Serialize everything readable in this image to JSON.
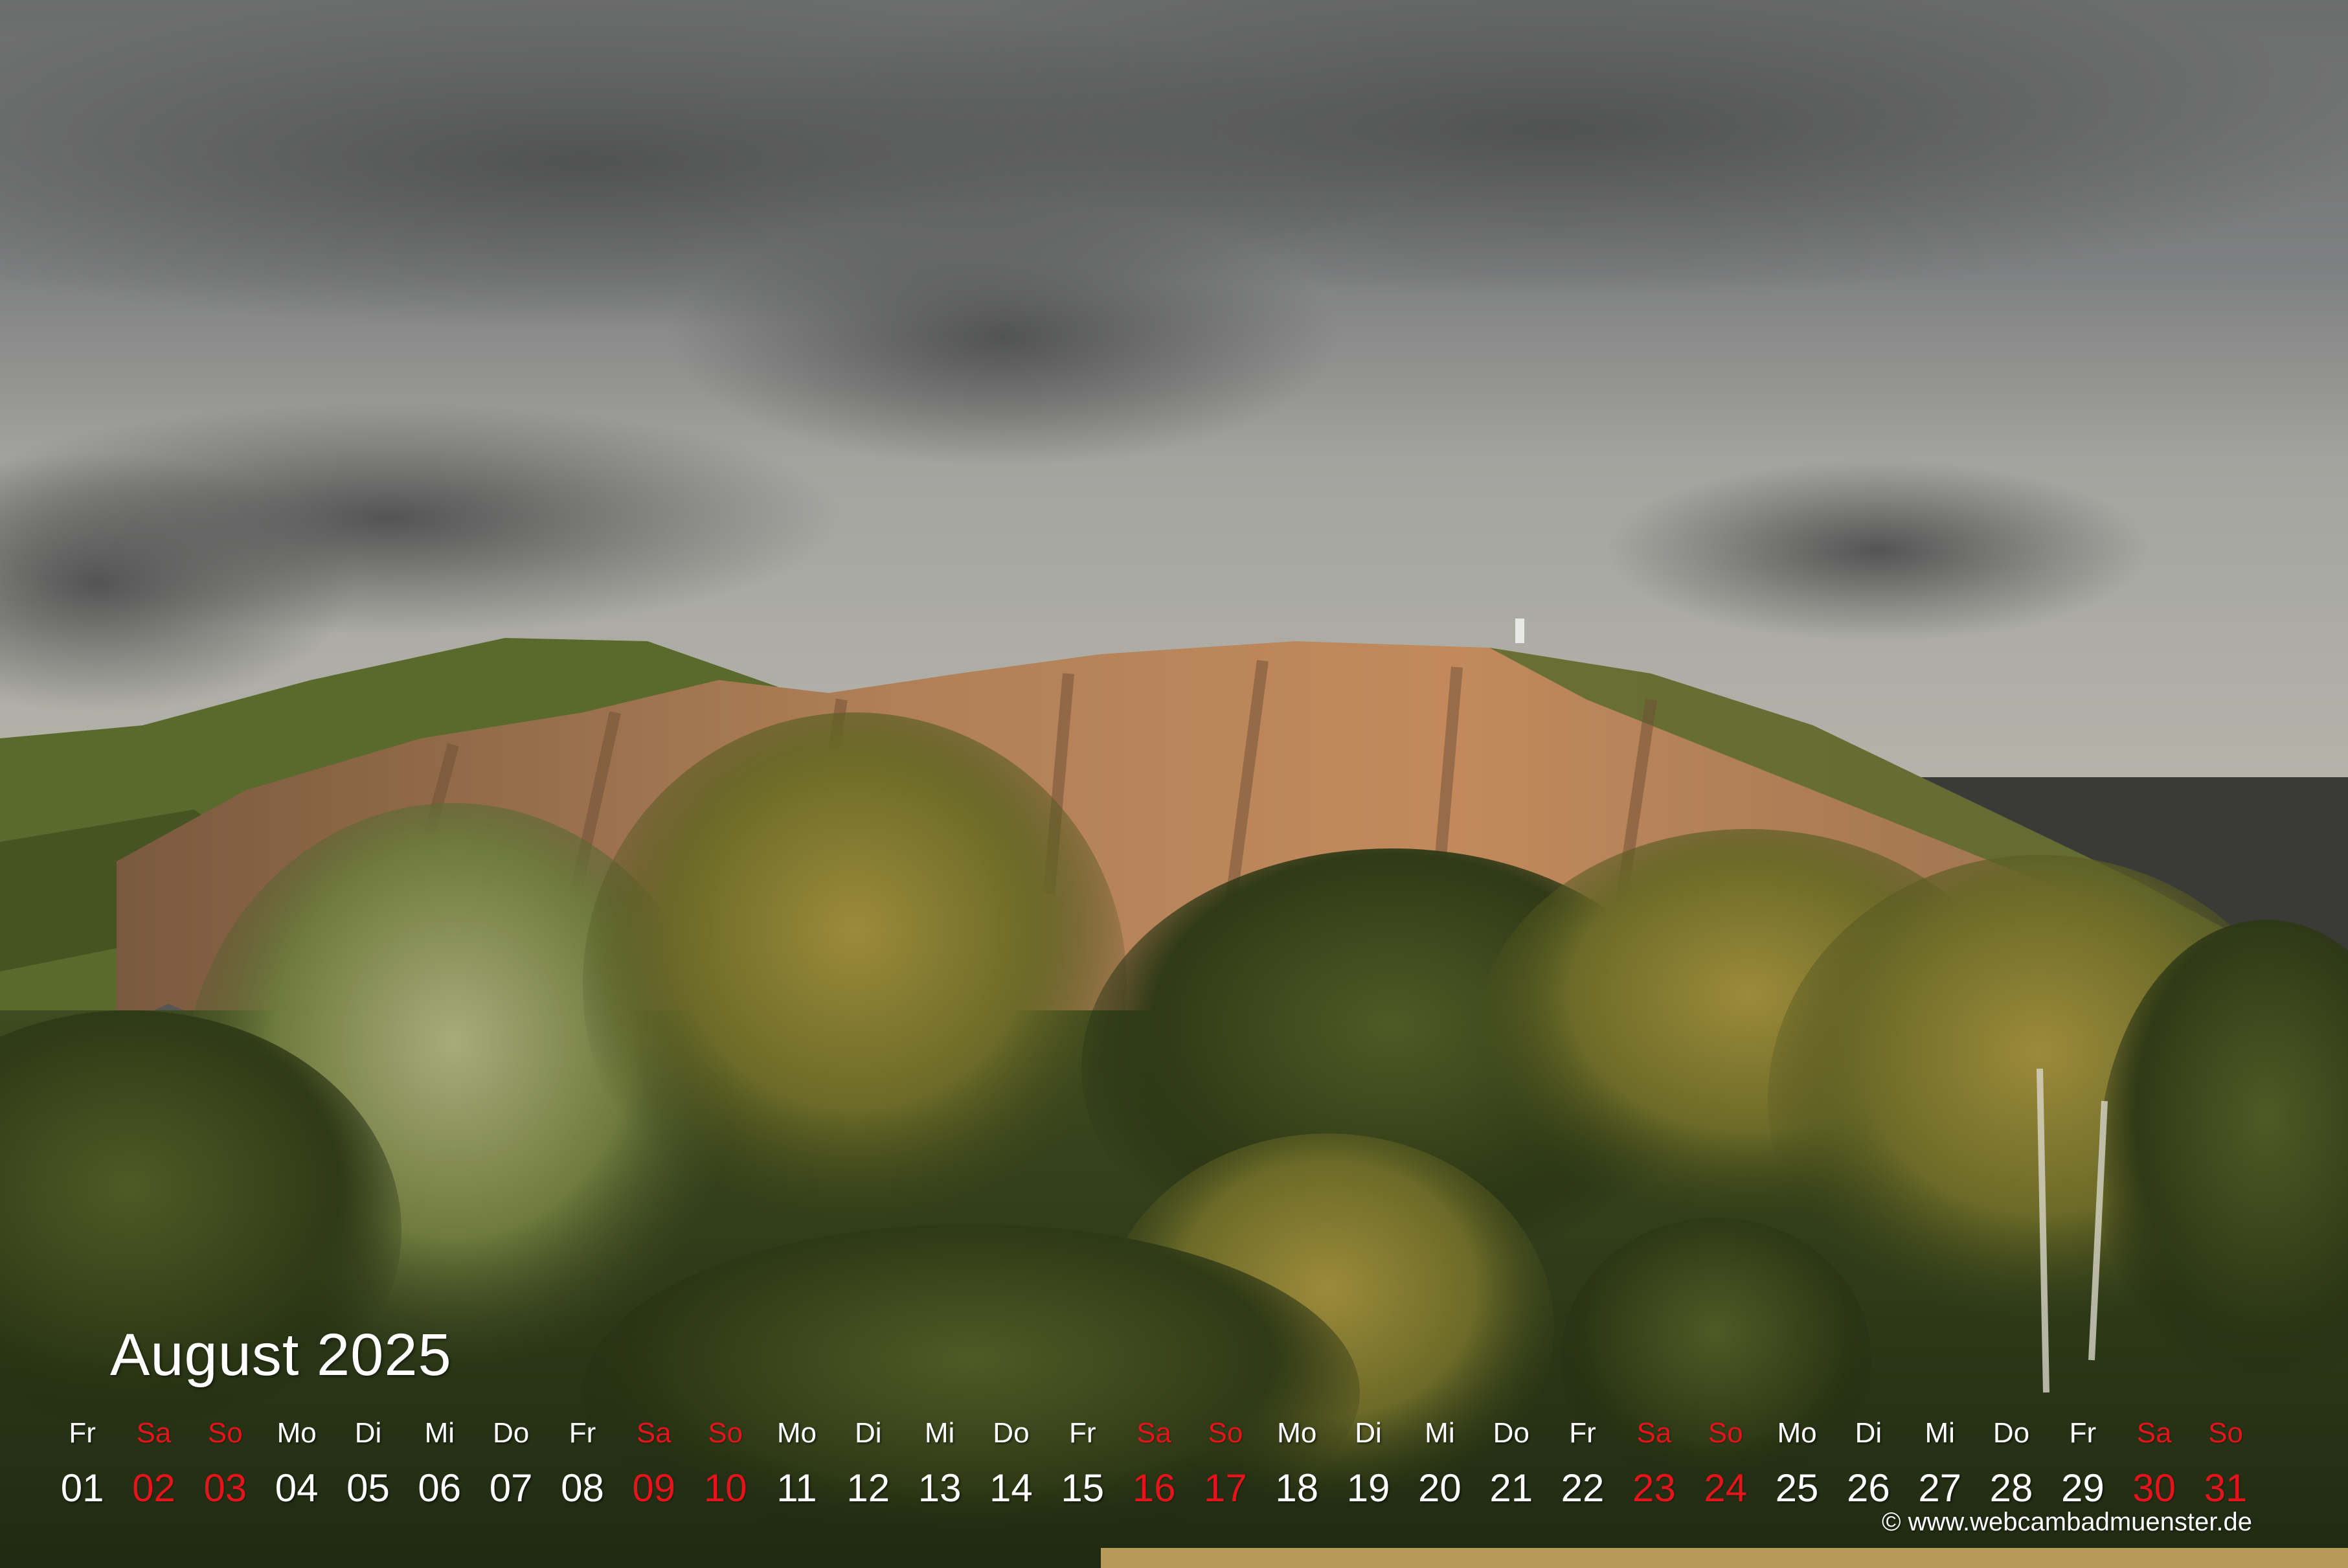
{
  "calendar": {
    "title": "August 2025",
    "days": [
      {
        "wd": "Fr",
        "dn": "01",
        "weekend": false
      },
      {
        "wd": "Sa",
        "dn": "02",
        "weekend": true
      },
      {
        "wd": "So",
        "dn": "03",
        "weekend": true
      },
      {
        "wd": "Mo",
        "dn": "04",
        "weekend": false
      },
      {
        "wd": "Di",
        "dn": "05",
        "weekend": false
      },
      {
        "wd": "Mi",
        "dn": "06",
        "weekend": false
      },
      {
        "wd": "Do",
        "dn": "07",
        "weekend": false
      },
      {
        "wd": "Fr",
        "dn": "08",
        "weekend": false
      },
      {
        "wd": "Sa",
        "dn": "09",
        "weekend": true
      },
      {
        "wd": "So",
        "dn": "10",
        "weekend": true
      },
      {
        "wd": "Mo",
        "dn": "11",
        "weekend": false
      },
      {
        "wd": "Di",
        "dn": "12",
        "weekend": false
      },
      {
        "wd": "Mi",
        "dn": "13",
        "weekend": false
      },
      {
        "wd": "Do",
        "dn": "14",
        "weekend": false
      },
      {
        "wd": "Fr",
        "dn": "15",
        "weekend": false
      },
      {
        "wd": "Sa",
        "dn": "16",
        "weekend": true
      },
      {
        "wd": "So",
        "dn": "17",
        "weekend": true
      },
      {
        "wd": "Mo",
        "dn": "18",
        "weekend": false
      },
      {
        "wd": "Di",
        "dn": "19",
        "weekend": false
      },
      {
        "wd": "Mi",
        "dn": "20",
        "weekend": false
      },
      {
        "wd": "Do",
        "dn": "21",
        "weekend": false
      },
      {
        "wd": "Fr",
        "dn": "22",
        "weekend": false
      },
      {
        "wd": "Sa",
        "dn": "23",
        "weekend": true
      },
      {
        "wd": "So",
        "dn": "24",
        "weekend": true
      },
      {
        "wd": "Mo",
        "dn": "25",
        "weekend": false
      },
      {
        "wd": "Di",
        "dn": "26",
        "weekend": false
      },
      {
        "wd": "Mi",
        "dn": "27",
        "weekend": false
      },
      {
        "wd": "Do",
        "dn": "28",
        "weekend": false
      },
      {
        "wd": "Fr",
        "dn": "29",
        "weekend": false
      },
      {
        "wd": "Sa",
        "dn": "30",
        "weekend": true
      },
      {
        "wd": "So",
        "dn": "31",
        "weekend": true
      }
    ]
  },
  "credit": "© www.webcambadmuenster.de",
  "colors": {
    "weekday": "#ffffff",
    "weekend": "#e3141b",
    "sky": "#8a8d8e",
    "rock": "#b07a4e",
    "foliage": "#3d4a22"
  }
}
